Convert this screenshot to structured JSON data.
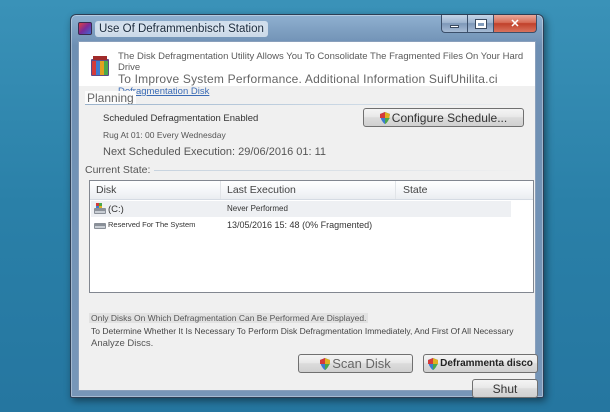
{
  "window": {
    "title": "Use Of Deframmenbisch Station"
  },
  "header": {
    "line1": "The Disk Defragmentation Utility Allows You To Consolidate The Fragmented Files On Your Hard Drive",
    "line2": "To Improve System Performance. Additional Information SuifUhilita.ci",
    "link": "Defragmentation Disk"
  },
  "planning": {
    "title": "Planning",
    "enabled": "Scheduled Defragmentation Enabled",
    "run": "Rug At 01: 00 Every Wednesday",
    "next": "Next Scheduled Execution: 29/06/2016 01: 11",
    "configure_label": "Configure Schedule..."
  },
  "current_state": {
    "title": "Current State:",
    "columns": [
      "Disk",
      "Last Execution",
      "State"
    ],
    "rows": [
      {
        "disk": "(C:)",
        "last": "Never Performed",
        "state": "",
        "icon": "hard-drive-os-icon"
      },
      {
        "disk": "Reserved For The System",
        "last": "13/05/2016 15: 48 (0% Fragmented)",
        "state": "",
        "icon": "hard-drive-icon"
      }
    ]
  },
  "notes": {
    "line1": "Only Disks On Which Defragmentation Can Be Performed Are Displayed.",
    "line2": "To Determine Whether It Is Necessary To Perform Disk Defragmentation Immediately, And First Of All Necessary",
    "line3": "Analyze Discs."
  },
  "buttons": {
    "scan_label": "Scan Disk",
    "defrag_label": "Deframmenta disco",
    "shut_label": "Shut"
  },
  "colors": {
    "desktop": "#2a80a8",
    "frame": "#7796b8",
    "close": "#c0402a",
    "link": "#3a6bb5"
  }
}
